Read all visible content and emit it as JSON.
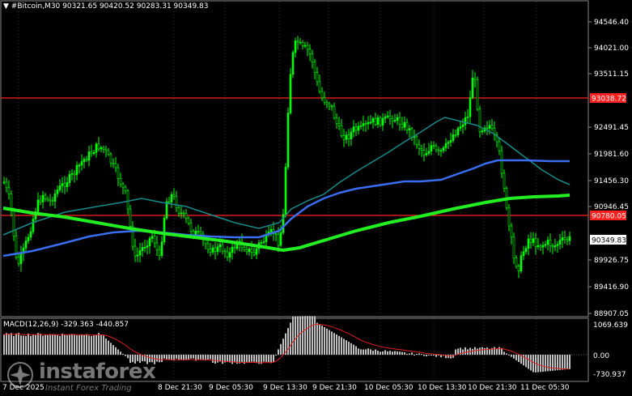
{
  "header": {
    "symbol_marker": "▼",
    "title": "#Bitcoin,M30  90321.65 90420.52 90283.31 90349.83"
  },
  "price_axis": {
    "labels": [
      "94546.40",
      "94021.00",
      "93511.15",
      "92491.45",
      "91981.60",
      "91456.30",
      "90946.45",
      "90436.60",
      "89926.75",
      "89416.90",
      "88907.05"
    ],
    "current_price": "90349.83",
    "levels": [
      {
        "value": "93038.72",
        "color": "#ff2020"
      },
      {
        "value": "90780.05",
        "color": "#ff2020"
      }
    ]
  },
  "macd": {
    "title": "MACD(12,26,9) -329.363 -440.857",
    "labels": [
      "1069.639",
      "0.00",
      "-730.937"
    ]
  },
  "time_axis": {
    "labels": [
      "7 Dec 2025",
      "8 Dec 21:30",
      "9 Dec 05:30",
      "9 Dec 13:30",
      "9 Dec 21:30",
      "10 Dec 05:30",
      "10 Dec 13:30",
      "10 Dec 21:30",
      "11 Dec 05:30"
    ]
  },
  "watermark": {
    "brand": "instaforex",
    "tagline": "Instant Forex Trading"
  },
  "colors": {
    "background": "#000000",
    "candle": "#00ff00",
    "ma_fast": "#1a8a8a",
    "ma_mid": "#3a6df0",
    "ma_slow": "#22ee22",
    "level": "#ff2020",
    "macd_hist": "#c0c0c0",
    "macd_signal": "#e02020",
    "price_tag_bg": "#ffffff"
  },
  "chart_data": {
    "type": "candlestick",
    "series": [
      {
        "name": "MA fast"
      },
      {
        "name": "MA mid"
      },
      {
        "name": "MA slow"
      }
    ]
  }
}
